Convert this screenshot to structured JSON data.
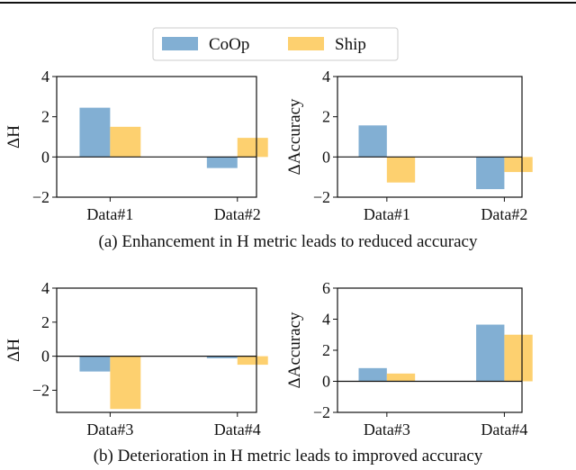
{
  "legend": {
    "position": "top-center",
    "entries": [
      {
        "name": "CoOp",
        "color": "#82afd3"
      },
      {
        "name": "Ship",
        "color": "#fdd06f"
      }
    ]
  },
  "captions": {
    "a": "(a) Enhancement in H metric leads to reduced accuracy",
    "b": "(b) Deterioration in H metric leads to improved accuracy"
  },
  "chart_data": [
    {
      "type": "bar",
      "ylabel": "ΔH",
      "categories": [
        "Data#1",
        "Data#2"
      ],
      "ylim": [
        -2,
        4
      ],
      "yticks": [
        -2,
        0,
        2,
        4
      ],
      "yticklabels": [
        "−2",
        "0",
        "2",
        "4"
      ],
      "series": [
        {
          "name": "CoOp",
          "values": [
            2.45,
            -0.55
          ]
        },
        {
          "name": "Ship",
          "values": [
            1.5,
            0.95
          ]
        }
      ]
    },
    {
      "type": "bar",
      "ylabel": "ΔAccuracy",
      "categories": [
        "Data#1",
        "Data#2"
      ],
      "ylim": [
        -2,
        4
      ],
      "yticks": [
        -2,
        0,
        2,
        4
      ],
      "yticklabels": [
        "−2",
        "0",
        "2",
        "4"
      ],
      "series": [
        {
          "name": "CoOp",
          "values": [
            1.57,
            -1.6
          ]
        },
        {
          "name": "Ship",
          "values": [
            -1.27,
            -0.75
          ]
        }
      ]
    },
    {
      "type": "bar",
      "ylabel": "ΔH",
      "categories": [
        "Data#3",
        "Data#4"
      ],
      "ylim": [
        -3.3,
        4
      ],
      "yticks": [
        -2,
        0,
        2,
        4
      ],
      "yticklabels": [
        "−2",
        "0",
        "2",
        "4"
      ],
      "series": [
        {
          "name": "CoOp",
          "values": [
            -0.9,
            -0.12
          ]
        },
        {
          "name": "Ship",
          "values": [
            -3.1,
            -0.5
          ]
        }
      ]
    },
    {
      "type": "bar",
      "ylabel": "ΔAccuracy",
      "categories": [
        "Data#3",
        "Data#4"
      ],
      "ylim": [
        -2,
        6
      ],
      "yticks": [
        -2,
        0,
        2,
        4,
        6
      ],
      "yticklabels": [
        "−2",
        "0",
        "2",
        "4",
        "6"
      ],
      "series": [
        {
          "name": "CoOp",
          "values": [
            0.85,
            3.65
          ]
        },
        {
          "name": "Ship",
          "values": [
            0.5,
            3.0
          ]
        }
      ]
    }
  ]
}
